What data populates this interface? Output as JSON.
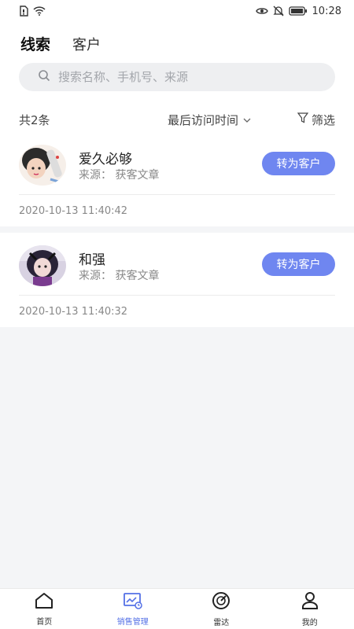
{
  "status_bar": {
    "time": "10:28",
    "left_icons": [
      "sim-icon",
      "wifi-icon"
    ],
    "right_icons": [
      "eye-icon",
      "bell-mute-icon",
      "battery-icon"
    ]
  },
  "tabs": [
    {
      "label": "线索",
      "active": true
    },
    {
      "label": "客户",
      "active": false
    }
  ],
  "search": {
    "placeholder": "搜索名称、手机号、来源",
    "value": ""
  },
  "list_meta": {
    "count_label": "共2条",
    "sort_label": "最后访问时间",
    "filter_label": "筛选"
  },
  "leads": [
    {
      "name": "爱久必够 ",
      "source_label": "来源：",
      "source": "获客文章",
      "action_label": "转为客户",
      "time": "2020-10-13 11:40:42"
    },
    {
      "name": "和强",
      "source_label": "来源：",
      "source": "获客文章",
      "action_label": "转为客户",
      "time": "2020-10-13 11:40:32"
    }
  ],
  "bottom_nav": [
    {
      "label": "首页",
      "icon": "home-icon",
      "active": false
    },
    {
      "label": "销售管理",
      "icon": "sales-icon",
      "active": true
    },
    {
      "label": "雷达",
      "icon": "radar-icon",
      "active": false
    },
    {
      "label": "我的",
      "icon": "profile-icon",
      "active": false
    }
  ],
  "colors": {
    "accent": "#6f86f0",
    "nav_active": "#5470e6",
    "background": "#f4f5f7"
  }
}
